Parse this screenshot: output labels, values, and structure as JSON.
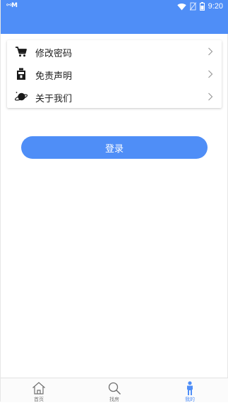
{
  "status_bar": {
    "left_text": "⚯M",
    "time": "9:20",
    "icons": [
      "wifi-icon",
      "no-sim-icon",
      "battery-icon"
    ]
  },
  "menu": {
    "items": [
      {
        "label": "修改密码",
        "icon": "cart-icon"
      },
      {
        "label": "免责声明",
        "icon": "statement-icon"
      },
      {
        "label": "关于我们",
        "icon": "planet-icon"
      }
    ]
  },
  "login": {
    "label": "登录"
  },
  "tabs": [
    {
      "label": "首页",
      "icon": "home-icon",
      "active": false
    },
    {
      "label": "找房",
      "icon": "search-icon",
      "active": false
    },
    {
      "label": "我的",
      "icon": "person-icon",
      "active": true
    }
  ],
  "colors": {
    "accent": "#4f8ef7",
    "tab_inactive": "#777777",
    "text": "#222222"
  }
}
